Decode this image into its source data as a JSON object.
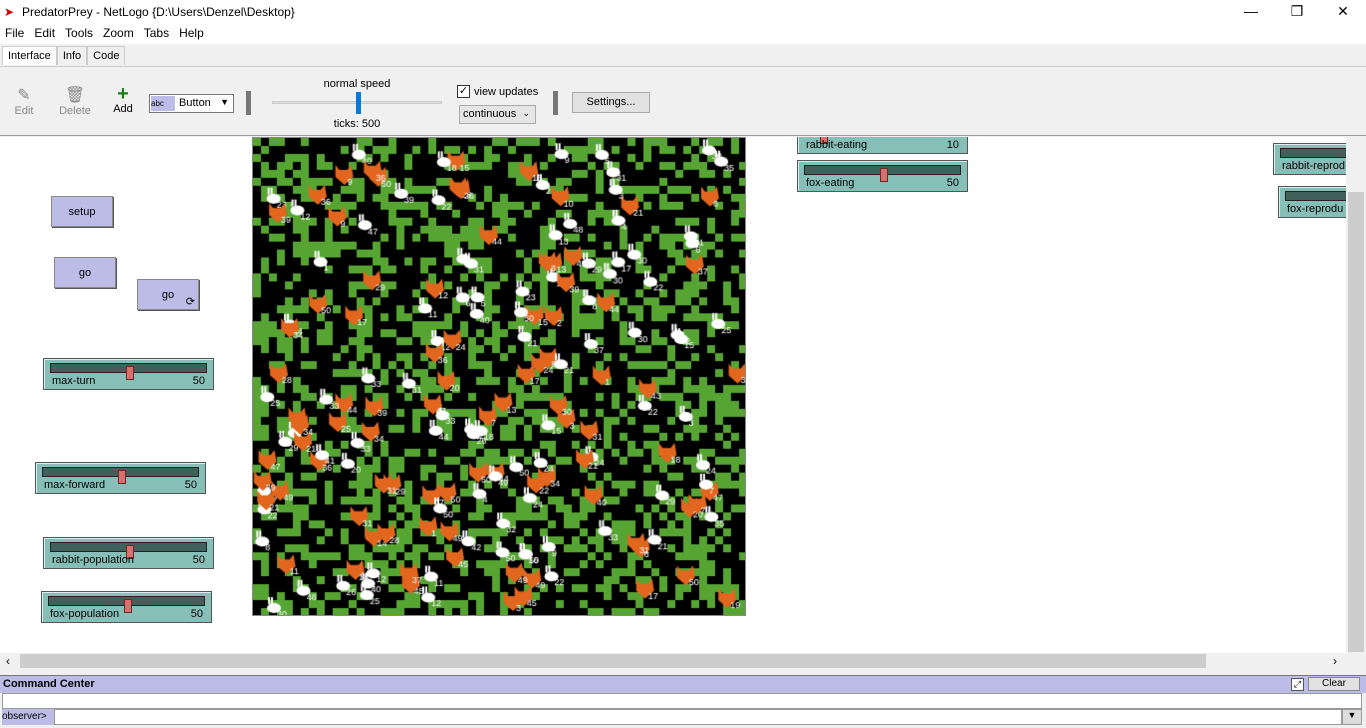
{
  "window": {
    "title": "PredatorPrey - NetLogo {D:\\Users\\Denzel\\Desktop}",
    "minimize": "—",
    "restore": "❐",
    "close": "✕"
  },
  "menu": [
    "File",
    "Edit",
    "Tools",
    "Zoom",
    "Tabs",
    "Help"
  ],
  "tabs": [
    "Interface",
    "Info",
    "Code"
  ],
  "toolbar": {
    "edit": "Edit",
    "delete": "Delete",
    "add": "Add",
    "widget_type": "Button",
    "speed_label": "normal speed",
    "speed": 0.5,
    "ticks": "ticks: 500",
    "view_updates_label": "view updates",
    "view_updates_checked": true,
    "update_mode": "continuous",
    "settings": "Settings..."
  },
  "buttons": {
    "setup": "setup",
    "go_once": "go",
    "go_forever": "go",
    "forever_icon": "⟳"
  },
  "sliders": [
    {
      "name": "max-turn",
      "value": "50",
      "fraction": 0.5
    },
    {
      "name": "max-forward",
      "value": "50",
      "fraction": 0.5
    },
    {
      "name": "rabbit-population",
      "value": "50",
      "fraction": 0.5
    },
    {
      "name": "fox-population",
      "value": "50",
      "fraction": 0.5
    },
    {
      "name": "rabbit-eating",
      "value": "10",
      "fraction": 0.1
    },
    {
      "name": "fox-eating",
      "value": "50",
      "fraction": 0.5
    },
    {
      "name": "rabbit-reprod",
      "value": ""
    },
    {
      "name": "fox-reprodu",
      "value": ""
    }
  ],
  "colors": {
    "grass": "#56a532",
    "patch": "#000000",
    "fox": "#e2661e",
    "rabbit": "#ffffff"
  },
  "command_center": {
    "title": "Command Center",
    "clear": "Clear",
    "prompt": "observer>",
    "input": ""
  }
}
